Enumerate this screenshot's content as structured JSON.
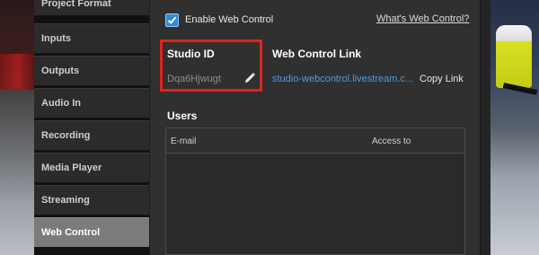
{
  "nav": {
    "items": [
      {
        "label": "Project Format"
      },
      {
        "label": "Inputs"
      },
      {
        "label": "Outputs"
      },
      {
        "label": "Audio In"
      },
      {
        "label": "Recording"
      },
      {
        "label": "Media Player"
      },
      {
        "label": "Streaming"
      },
      {
        "label": "Web Control"
      }
    ],
    "active": "Web Control"
  },
  "web_control": {
    "enable_label": "Enable Web Control",
    "enable_checked": true,
    "whats_link": "What's Web Control?",
    "studio_id_heading": "Studio ID",
    "studio_id_value": "Dqa6Hjwugt",
    "web_link_heading": "Web Control Link",
    "web_link_value": "studio-webcontrol.livestream.c...",
    "copy_link_label": "Copy Link"
  },
  "users": {
    "heading": "Users",
    "columns": [
      "E-mail",
      "Access to"
    ],
    "rows": []
  },
  "colors": {
    "accent_blue": "#2f8bd6",
    "link_blue": "#4a9be0",
    "highlight_red": "#e0241b",
    "active_nav": "#7b7b7b"
  },
  "icons": [
    "checkbox-checked-icon",
    "pencil-icon"
  ]
}
